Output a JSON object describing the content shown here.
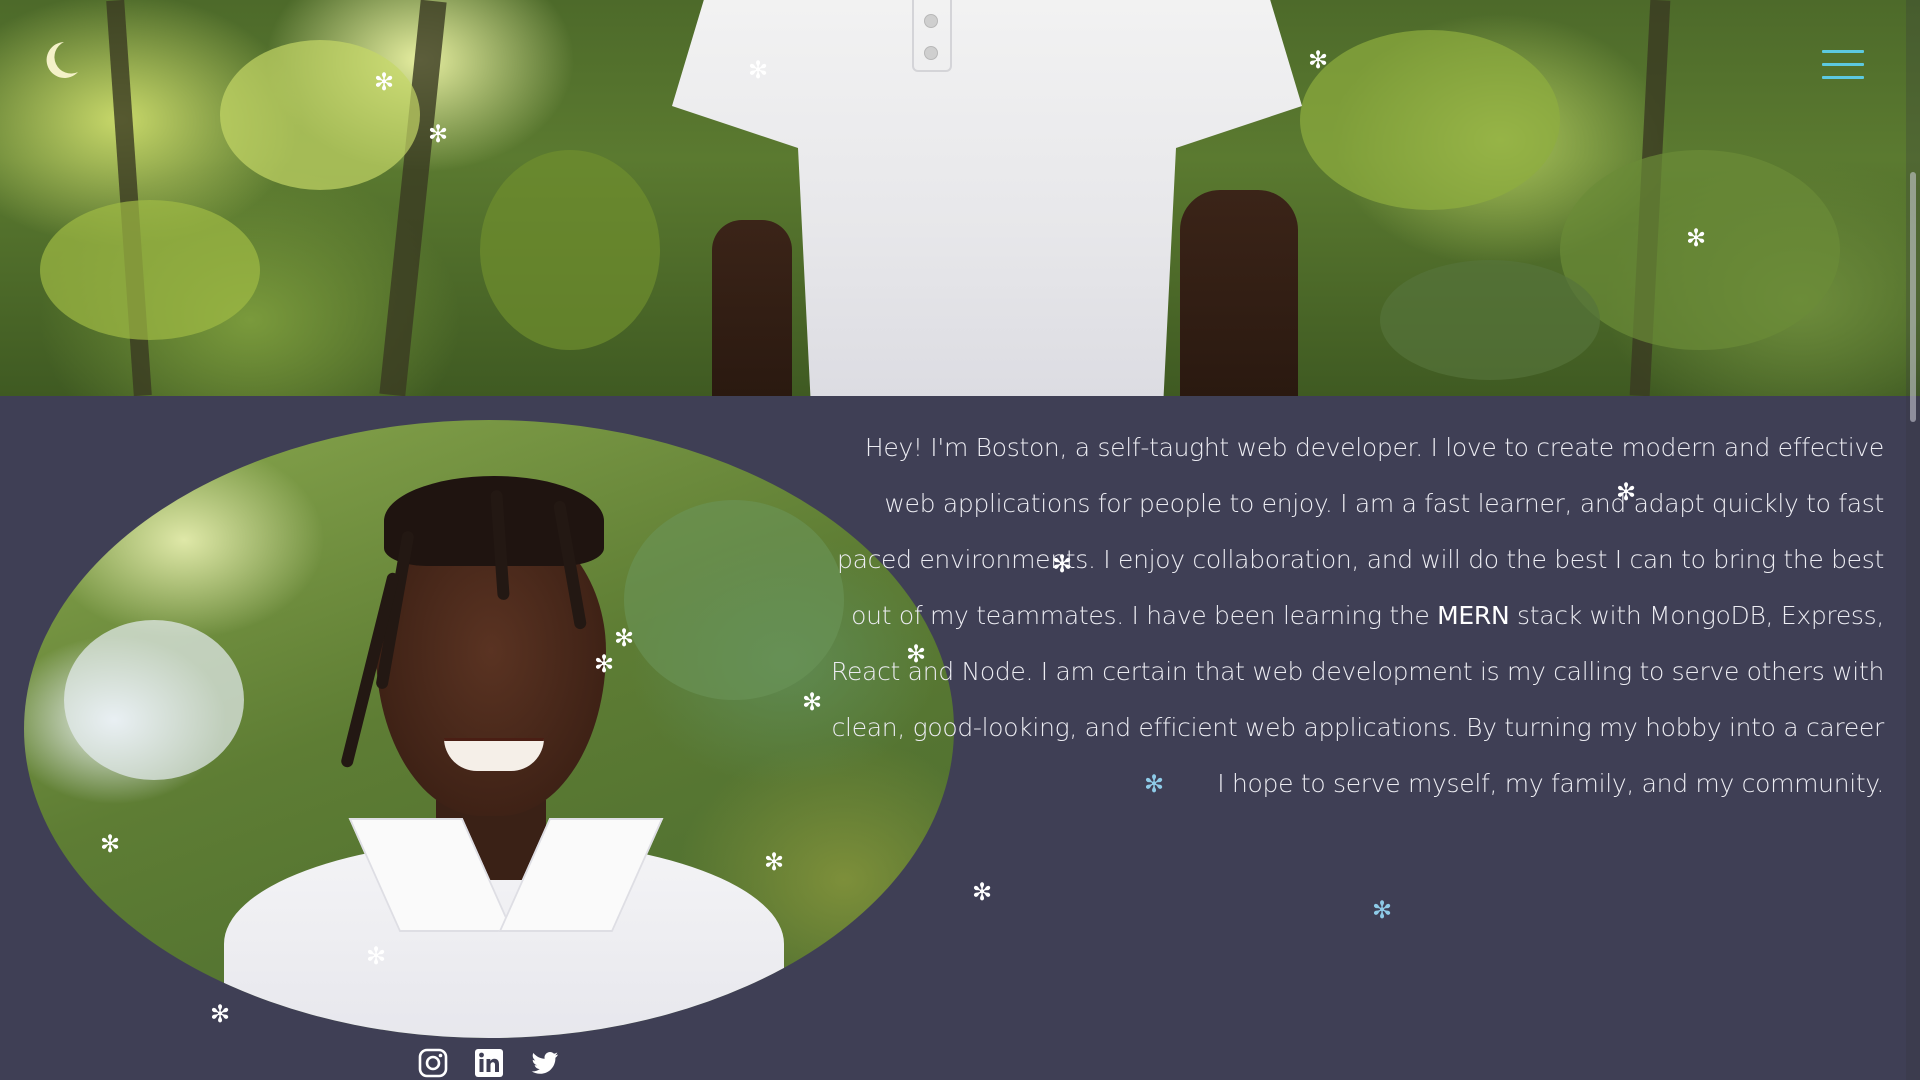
{
  "hero": {
    "image_alt": "Boston in a white polo shirt standing in a forest"
  },
  "header": {
    "theme_toggle_icon": "crescent-moon-icon",
    "menu_icon": "hamburger-menu-icon",
    "menu_color": "#5cc9e0"
  },
  "about": {
    "portrait_alt": "Portrait of Boston smiling among green trees",
    "text_before": "Hey! I'm Boston, a self-taught web developer. I love to create modern and effective web applications for people to enjoy. I am a fast learner, and adapt quickly to fast paced environments. I enjoy collaboration, and will do the best I can to bring the best out of my teammates. I have been learning the ",
    "highlight": "MERN",
    "text_after": " stack with MongoDB, Express, React and Node. I am certain that web development is my calling to serve others with clean, good-looking, and efficient web applications. By turning my hobby into a career I hope to serve myself, my family, and my community."
  },
  "social": [
    {
      "icon": "instagram-icon",
      "label": "Instagram"
    },
    {
      "icon": "linkedin-icon",
      "label": "LinkedIn"
    },
    {
      "icon": "twitter-icon",
      "label": "Twitter"
    }
  ],
  "snowflake_glyph": "✻",
  "colors": {
    "background": "#3f3f55",
    "text": "#ececf2",
    "accent": "#5cc9e0",
    "snow": "#ffffff",
    "snow_blue": "#8ecbe8"
  }
}
